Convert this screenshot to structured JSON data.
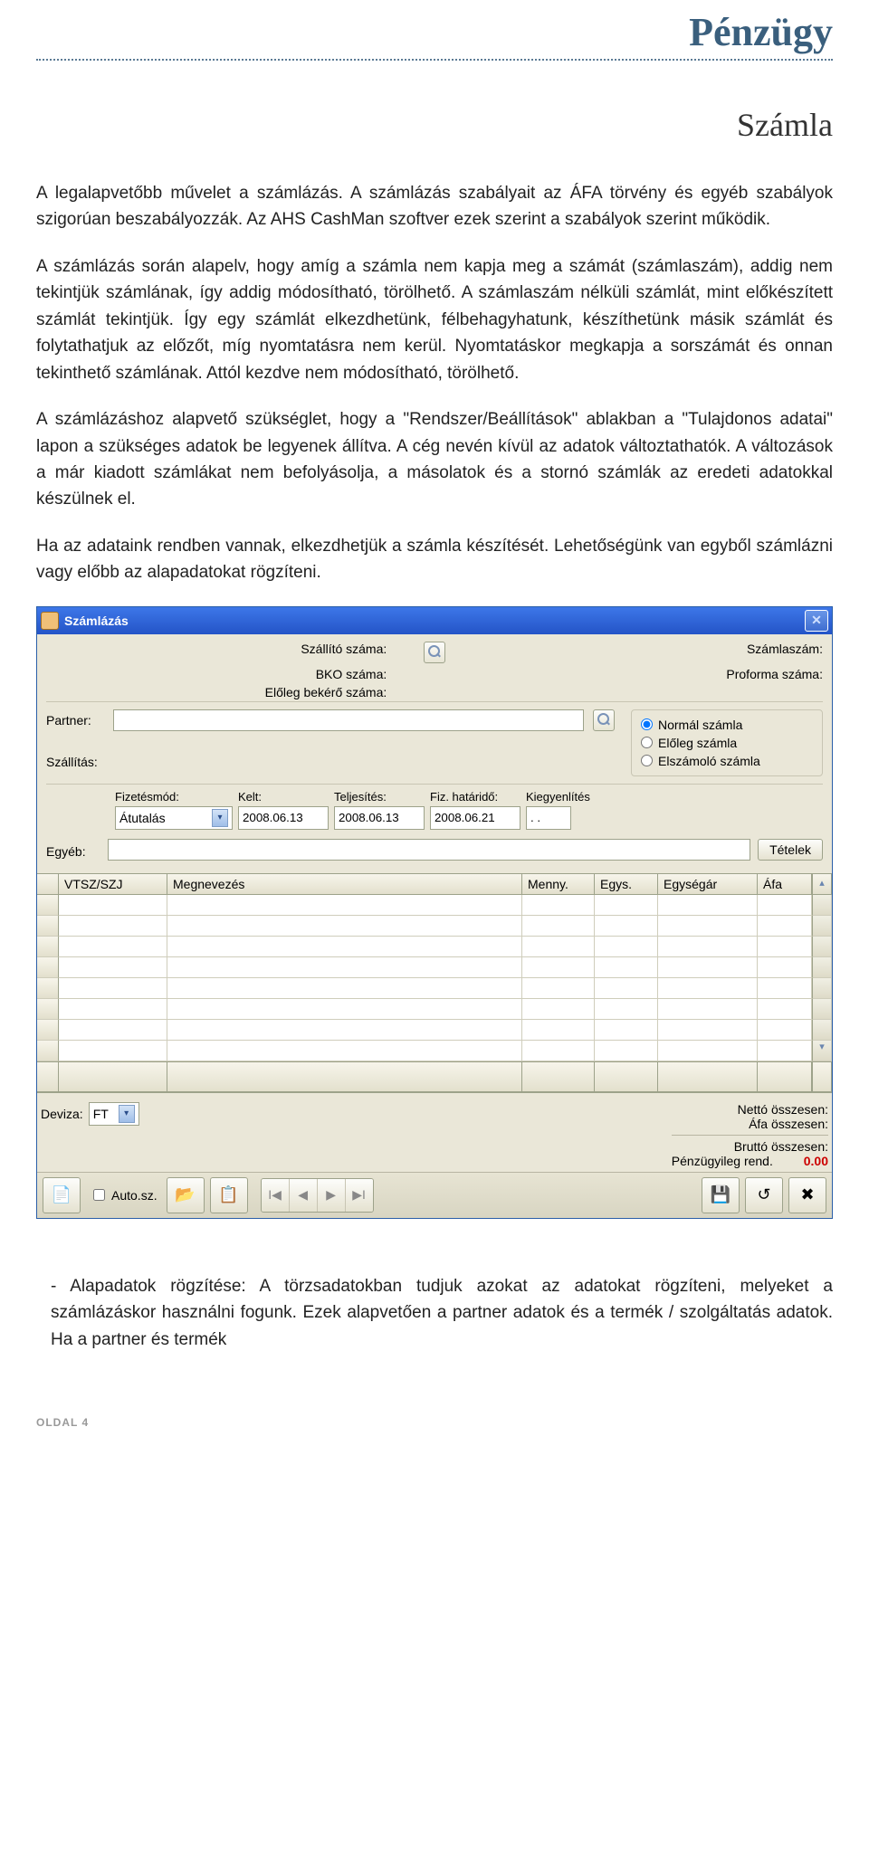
{
  "brand": "Pénzügy",
  "page_title": "Számla",
  "paragraphs": {
    "p1": "A legalapvetőbb művelet a számlázás. A számlázás szabályait az ÁFA törvény és egyéb szabályok szigorúan beszabályozzák. Az AHS CashMan szoftver ezek szerint a szabályok szerint működik.",
    "p2": "A számlázás során alapelv, hogy amíg a számla nem kapja meg a számát (számlaszám), addig nem tekintjük számlának, így addig módosítható, törölhető. A számlaszám nélküli számlát, mint előkészített számlát tekintjük. Így egy számlát elkezdhetünk, félbehagyhatunk, készíthetünk másik számlát és folytathatjuk az előzőt, míg nyomtatásra nem kerül. Nyomtatáskor megkapja a sorszámát és onnan tekinthető számlának. Attól kezdve nem módosítható, törölhető.",
    "p3": "A számlázáshoz alapvető szükséglet, hogy a \"Rendszer/Beállítások\" ablakban a \"Tulajdonos adatai\" lapon a szükséges adatok be legyenek állítva. A cég nevén kívül az adatok változtathatók. A változások a már kiadott számlákat nem befolyásolja, a másolatok és a stornó számlák az eredeti adatokkal készülnek el.",
    "p4": "Ha az adataink rendben vannak, elkezdhetjük a számla készítését. Lehetőségünk van egyből számlázni vagy előbb az alapadatokat rögzíteni."
  },
  "window": {
    "title": "Számlázás",
    "top": {
      "left": {
        "l1": "Szállító száma:",
        "l2": "BKO száma:",
        "l3": "Előleg bekérő száma:"
      },
      "right": {
        "r1": "Számlaszám:",
        "r2": "Proforma száma:"
      }
    },
    "partner": {
      "label": "Partner:",
      "szallitas_label": "Szállítás:",
      "radio": {
        "normal": "Normál számla",
        "eloleg": "Előleg számla",
        "elszamolo": "Elszámoló számla"
      }
    },
    "dates": {
      "fizmod_label": "Fizetésmód:",
      "fizmod_value": "Átutalás",
      "kelt_label": "Kelt:",
      "kelt_value": "2008.06.13",
      "teljesites_label": "Teljesítés:",
      "teljesites_value": "2008.06.13",
      "fizhat_label": "Fiz. határidő:",
      "fizhat_value": "2008.06.21",
      "kieg_label": "Kiegyenlítés",
      "kieg_value": ". ."
    },
    "egyeb_label": "Egyéb:",
    "tetelek_btn": "Tételek",
    "grid_headers": {
      "vtsz": "VTSZ/SZJ",
      "megn": "Megnevezés",
      "menny": "Menny.",
      "egys": "Egys.",
      "egysegar": "Egységár",
      "afa": "Áfa"
    },
    "totals": {
      "deviza_label": "Deviza:",
      "deviza_value": "FT",
      "netto": "Nettó összesen:",
      "afa": "Áfa összesen:",
      "brutto": "Bruttó összesen:",
      "penzugy": "Pénzügyileg rend.",
      "penzugy_value": "0.00"
    },
    "auto_sz": "Auto.sz."
  },
  "after_note": "- Alapadatok rögzítése: A törzsadatokban tudjuk azokat az adatokat rögzíteni, melyeket a számlázáskor használni fogunk. Ezek alapvetően a partner adatok és a termék / szolgáltatás adatok. Ha a partner és termék",
  "page_footer": "OLDAL 4"
}
